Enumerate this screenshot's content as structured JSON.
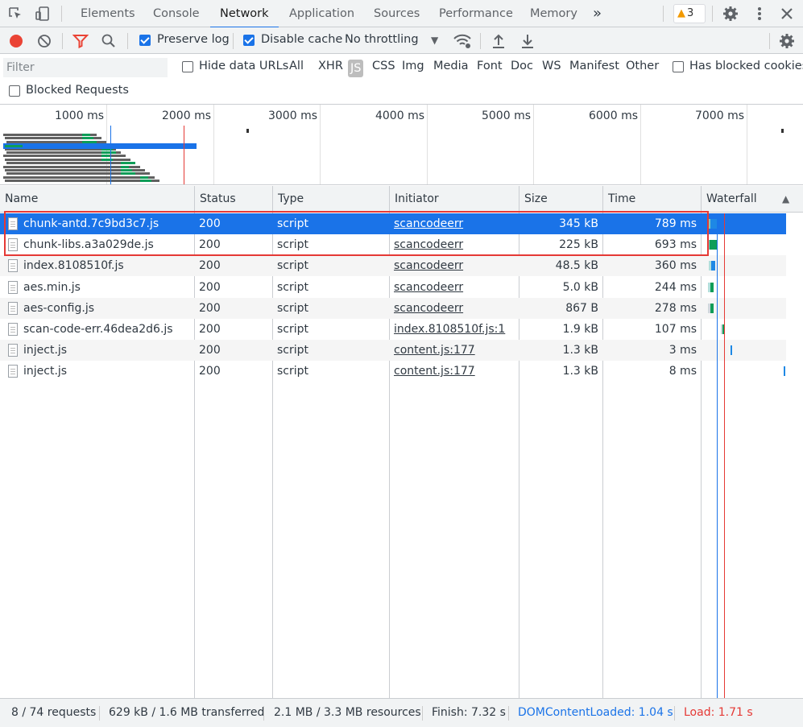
{
  "tabs": [
    {
      "label": "Elements"
    },
    {
      "label": "Console"
    },
    {
      "label": "Network",
      "active": true
    },
    {
      "label": "Application"
    },
    {
      "label": "Sources"
    },
    {
      "label": "Performance"
    },
    {
      "label": "Memory"
    }
  ],
  "more_tabs_icon": "double-chevron-right-icon",
  "warnings_count": "3",
  "toolbar": {
    "preserve_log_label": "Preserve log",
    "preserve_log_checked": true,
    "disable_cache_label": "Disable cache",
    "disable_cache_checked": true,
    "throttling": "No throttling"
  },
  "filter": {
    "placeholder": "Filter",
    "hide_data_urls_label": "Hide data URLs",
    "types": [
      "All",
      "XHR",
      "JS",
      "CSS",
      "Img",
      "Media",
      "Font",
      "Doc",
      "WS",
      "Manifest",
      "Other"
    ],
    "selected_type": "JS",
    "has_blocked_cookies_label": "Has blocked cookies",
    "blocked_requests_label": "Blocked Requests"
  },
  "overview": {
    "ticks": [
      "1000 ms",
      "2000 ms",
      "3000 ms",
      "4000 ms",
      "5000 ms",
      "6000 ms",
      "7000 ms"
    ]
  },
  "columns": [
    "Name",
    "Status",
    "Type",
    "Initiator",
    "Size",
    "Time",
    "Waterfall"
  ],
  "requests": [
    {
      "name": "chunk-antd.7c9bd3c7.js",
      "status": "200",
      "type": "script",
      "initiator": "scancodeerr",
      "size": "345 kB",
      "time": "789 ms"
    },
    {
      "name": "chunk-libs.a3a029de.js",
      "status": "200",
      "type": "script",
      "initiator": "scancodeerr",
      "size": "225 kB",
      "time": "693 ms"
    },
    {
      "name": "index.8108510f.js",
      "status": "200",
      "type": "script",
      "initiator": "scancodeerr",
      "size": "48.5 kB",
      "time": "360 ms"
    },
    {
      "name": "aes.min.js",
      "status": "200",
      "type": "script",
      "initiator": "scancodeerr",
      "size": "5.0 kB",
      "time": "244 ms"
    },
    {
      "name": "aes-config.js",
      "status": "200",
      "type": "script",
      "initiator": "scancodeerr",
      "size": "867 B",
      "time": "278 ms"
    },
    {
      "name": "scan-code-err.46dea2d6.js",
      "status": "200",
      "type": "script",
      "initiator": "index.8108510f.js:1",
      "size": "1.9 kB",
      "time": "107 ms"
    },
    {
      "name": "inject.js",
      "status": "200",
      "type": "script",
      "initiator": "content.js:177",
      "size": "1.3 kB",
      "time": "3 ms"
    },
    {
      "name": "inject.js",
      "status": "200",
      "type": "script",
      "initiator": "content.js:177",
      "size": "1.3 kB",
      "time": "8 ms"
    }
  ],
  "status_bar": {
    "requests": "8 / 74 requests",
    "transferred": "629 kB / 1.6 MB transferred",
    "resources": "2.1 MB / 3.3 MB resources",
    "finish": "Finish: 7.32 s",
    "dom_content_loaded": "DOMContentLoaded: 1.04 s",
    "load": "Load: 1.71 s"
  },
  "colors": {
    "accent": "#1a73e8",
    "record": "#ea4335",
    "load_line": "#e53935",
    "dcl_line": "#1a73e8",
    "highlight_box": "#e53935"
  }
}
